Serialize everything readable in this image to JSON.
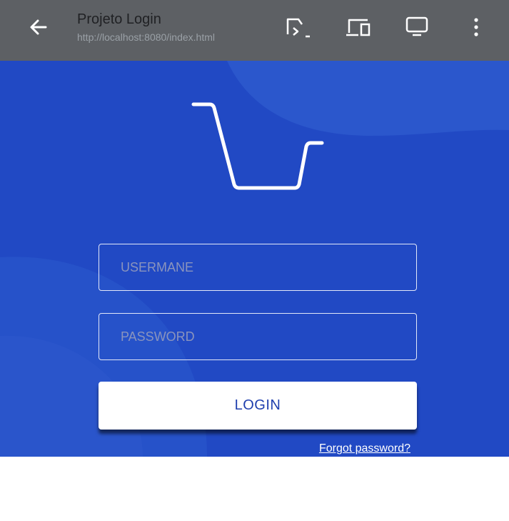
{
  "header": {
    "title": "Projeto Login",
    "url": "http://localhost:8080/index.html",
    "icons": {
      "back": "arrow-back-icon",
      "actions": [
        "cast-icon",
        "devices-icon",
        "monitor-icon",
        "more-vert-icon"
      ]
    }
  },
  "login": {
    "logo": "shopping-basket-icon",
    "username_placeholder": "USERMANE",
    "password_placeholder": "PASSWORD",
    "login_label": "LOGIN",
    "forgot_label": "Forgot password?"
  },
  "colors": {
    "topbar": "#5d6064",
    "background": "#2149c4",
    "accent_text": "#1f3fae",
    "button_bg": "#ffffff"
  }
}
